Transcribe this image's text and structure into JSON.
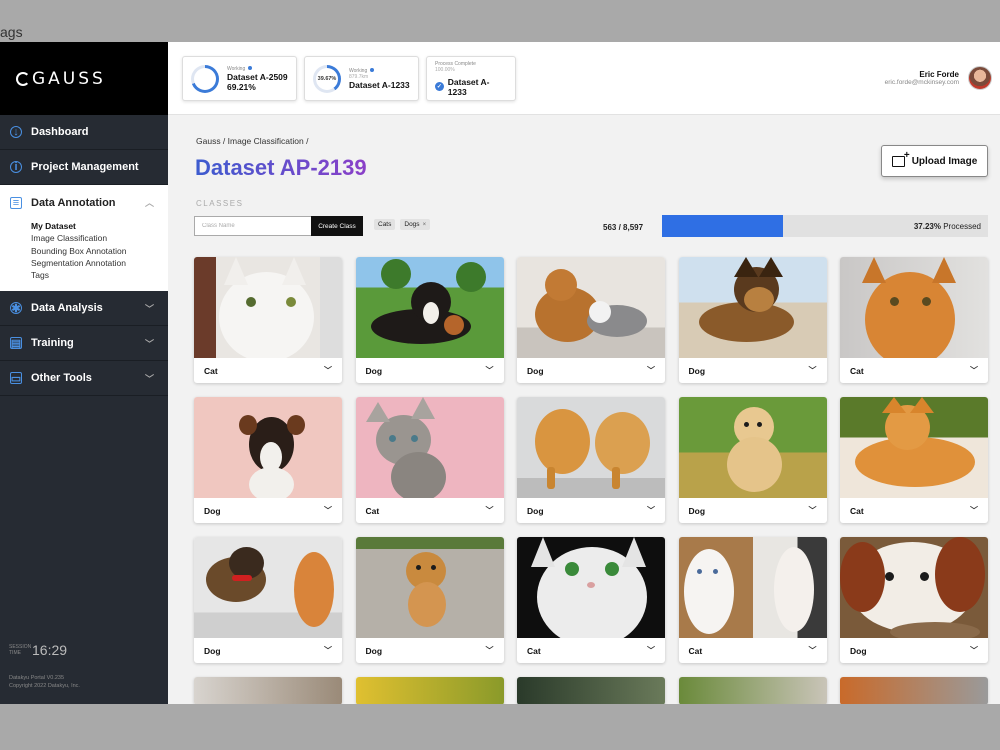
{
  "frame": {
    "title": "ags"
  },
  "sidebar": {
    "logo": "GAUSS",
    "items": [
      {
        "label": "Dashboard",
        "icon": "dashboard-icon"
      },
      {
        "label": "Project Management",
        "icon": "info-icon"
      },
      {
        "label": "Data Annotation",
        "icon": "annotation-icon",
        "expanded": true,
        "subitems": [
          "My Dataset",
          "Image Classification",
          "Bounding Box Annotation",
          "Segmentation Annotation",
          "Tags"
        ]
      },
      {
        "label": "Data Analysis",
        "icon": "bulb-icon"
      },
      {
        "label": "Training",
        "icon": "training-icon"
      },
      {
        "label": "Other Tools",
        "icon": "toolbox-icon"
      }
    ],
    "clock_label": "SESSION TIME",
    "clock": "16:29",
    "footer_line1": "Datakyu Portal V0.235",
    "footer_line2": "Copyright 2022 Datakyu, Inc."
  },
  "topbar": {
    "jobs": [
      {
        "status": "Working",
        "name": "Dataset A-2509",
        "pct": "69.21%",
        "progress": 0.6921
      },
      {
        "status": "Working",
        "sub": "879.7km",
        "ring_label": "39.67%",
        "name": "Dataset A-1233",
        "progress": 0.3967
      },
      {
        "status": "Process Complete",
        "sub": "100.00%",
        "name": "Dataset A-1233"
      }
    ],
    "user": {
      "name": "Eric Forde",
      "email": "eric.forde@mckinsey.com"
    }
  },
  "main": {
    "breadcrumb": "Gauss / Image Classification /",
    "title": "Dataset AP-2139",
    "upload_label": "Upload Image",
    "classes_label": "CLASSES",
    "class_input_placeholder": "Class Name",
    "create_label": "Create Class",
    "tags": [
      "Cats",
      "Dogs"
    ],
    "tag_close": "×",
    "count": "563 / 8,597",
    "processed_pct": "37.23%",
    "processed_suffix": " Processed",
    "processed_fraction": 0.3723,
    "images": [
      {
        "label": "Cat",
        "subject": "white-cat"
      },
      {
        "label": "Dog",
        "subject": "bernese-dog"
      },
      {
        "label": "Dog",
        "subject": "golden-dog-and-cat"
      },
      {
        "label": "Dog",
        "subject": "german-shepherd"
      },
      {
        "label": "Cat",
        "subject": "orange-cat"
      },
      {
        "label": "Dog",
        "subject": "terrier-pink"
      },
      {
        "label": "Cat",
        "subject": "tabby-kitten"
      },
      {
        "label": "Dog",
        "subject": "pomeranians"
      },
      {
        "label": "Dog",
        "subject": "golden-puppy"
      },
      {
        "label": "Cat",
        "subject": "ginger-cat-sleeping"
      },
      {
        "label": "Dog",
        "subject": "puppy-and-kitten"
      },
      {
        "label": "Dog",
        "subject": "golden-puppy-walk"
      },
      {
        "label": "Cat",
        "subject": "white-cat-green-eyes"
      },
      {
        "label": "Cat",
        "subject": "white-kittens"
      },
      {
        "label": "Dog",
        "subject": "cavalier"
      }
    ]
  }
}
